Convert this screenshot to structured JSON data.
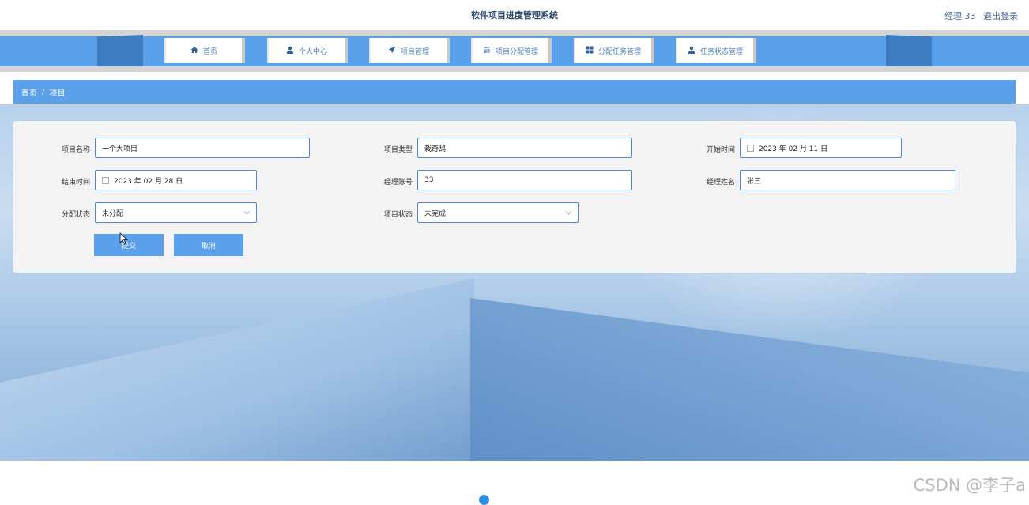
{
  "header": {
    "title": "软件项目进度管理系统",
    "user_label": "经理 33",
    "logout_label": "退出登录"
  },
  "nav": {
    "items": [
      {
        "label": "首页",
        "icon": "home-icon"
      },
      {
        "label": "个人中心",
        "icon": "user-icon"
      },
      {
        "label": "项目管理",
        "icon": "send-icon"
      },
      {
        "label": "项目分配管理",
        "icon": "sliders-icon"
      },
      {
        "label": "分配任务管理",
        "icon": "grid-icon"
      },
      {
        "label": "任务状态管理",
        "icon": "user-icon"
      }
    ]
  },
  "breadcrumb": {
    "home": "首页",
    "separator": "/",
    "current": "项目"
  },
  "form": {
    "project_name": {
      "label": "项目名称",
      "value": "一个大项目"
    },
    "project_type": {
      "label": "项目类型",
      "value": "栽奇鸹"
    },
    "start_time": {
      "label": "开始时间",
      "value": "2023 年 02 月 11 日"
    },
    "end_time": {
      "label": "结束时间",
      "value": "2023 年 02 月 28 日"
    },
    "manager_account": {
      "label": "经理账号",
      "value": "33"
    },
    "manager_name": {
      "label": "经理姓名",
      "value": "张三"
    },
    "assign_status": {
      "label": "分配状态",
      "value": "未分配"
    },
    "project_status": {
      "label": "项目状态",
      "value": "未完成"
    },
    "submit_label": "提交",
    "cancel_label": "取消"
  },
  "watermark": "CSDN @李子a",
  "colors": {
    "accent": "#5aa0ea",
    "nav_dark": "#3d7dc2",
    "field_border": "#4b8ad6",
    "title": "#2d4a6e"
  }
}
